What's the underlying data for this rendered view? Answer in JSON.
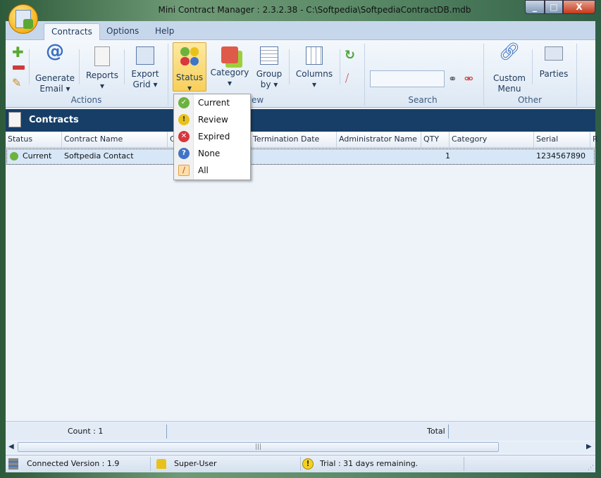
{
  "window": {
    "title": "Mini Contract Manager : 2.3.2.38 - C:\\Softpedia\\SoftpediaContractDB.mdb",
    "minimize": "_",
    "maximize": "□",
    "close": "X"
  },
  "tabs": [
    {
      "label": "Contracts",
      "active": true
    },
    {
      "label": "Options"
    },
    {
      "label": "Help"
    }
  ],
  "ribbon": {
    "actions": {
      "generate_email": "Generate Email",
      "reports": "Reports",
      "export_grid": "Export Grid",
      "group": "Actions"
    },
    "view": {
      "status": "Status",
      "category": "Category",
      "group_by": "Group by",
      "columns": "Columns",
      "group": "View"
    },
    "search": {
      "value": "",
      "group": "Search"
    },
    "other": {
      "custom_menu": "Custom Menu",
      "parties": "Parties",
      "group": "Other"
    }
  },
  "panel": {
    "title": "Contracts"
  },
  "grid": {
    "columns": [
      "Status",
      "Contract Name",
      "C",
      "Termination Date",
      "Administrator Name",
      "QTY",
      "Category",
      "Serial Number",
      "R"
    ],
    "rows": [
      {
        "status": "Current",
        "contract_name": "Softpedia Contact",
        "qty": "1",
        "serial": "1234567890"
      }
    ]
  },
  "status_menu": {
    "items": [
      {
        "label": "Current",
        "icon": "check-icon",
        "color": "#6cb33e"
      },
      {
        "label": "Review",
        "icon": "warning-icon",
        "color": "#e8c21a"
      },
      {
        "label": "Expired",
        "icon": "x-icon",
        "color": "#d9363e"
      },
      {
        "label": "None",
        "icon": "question-icon",
        "color": "#3f74c8"
      },
      {
        "label": "All",
        "icon": "clear-filter-icon",
        "color": "#d9363e"
      }
    ]
  },
  "footer": {
    "count": "Count : 1",
    "total": "Total"
  },
  "statusbar": {
    "version": "Connected Version : 1.9",
    "user": "Super-User",
    "trial": "Trial : 31 days remaining."
  }
}
